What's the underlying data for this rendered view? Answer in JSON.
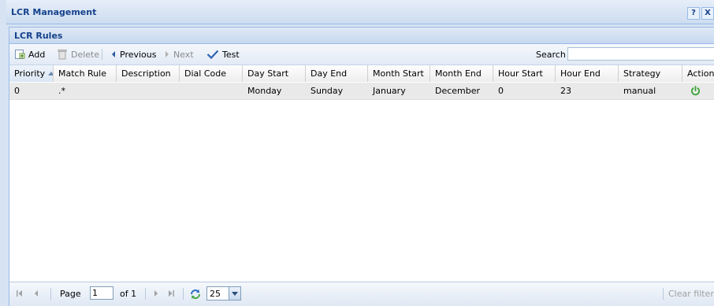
{
  "window": {
    "title": "LCR Management",
    "help_glyph": "?",
    "close_glyph": "X"
  },
  "panel": {
    "title": "LCR Rules"
  },
  "toolbar": {
    "add_label": "Add",
    "delete_label": "Delete",
    "previous_label": "Previous",
    "next_label": "Next",
    "test_label": "Test",
    "search_label": "Search",
    "search_value": ""
  },
  "grid": {
    "columns": [
      "Priority",
      "Match Rule",
      "Description",
      "Dial Code",
      "Day Start",
      "Day End",
      "Month Start",
      "Month End",
      "Hour Start",
      "Hour End",
      "Strategy",
      "Actions"
    ],
    "sorted_column": "Priority",
    "rows": [
      {
        "priority": "0",
        "match_rule": ".*",
        "description": "",
        "dial_code": "",
        "day_start": "Monday",
        "day_end": "Sunday",
        "month_start": "January",
        "month_end": "December",
        "hour_start": "0",
        "hour_end": "23",
        "strategy": "manual",
        "action_icon": "power-icon"
      }
    ]
  },
  "pager": {
    "page_label": "Page",
    "page_value": "1",
    "of_label": "of 1",
    "page_size": "25",
    "clear_filters_label": "Clear filters"
  },
  "colors": {
    "accent": "#15428b",
    "border": "#99bbe8",
    "power_icon": "#3aa335"
  }
}
